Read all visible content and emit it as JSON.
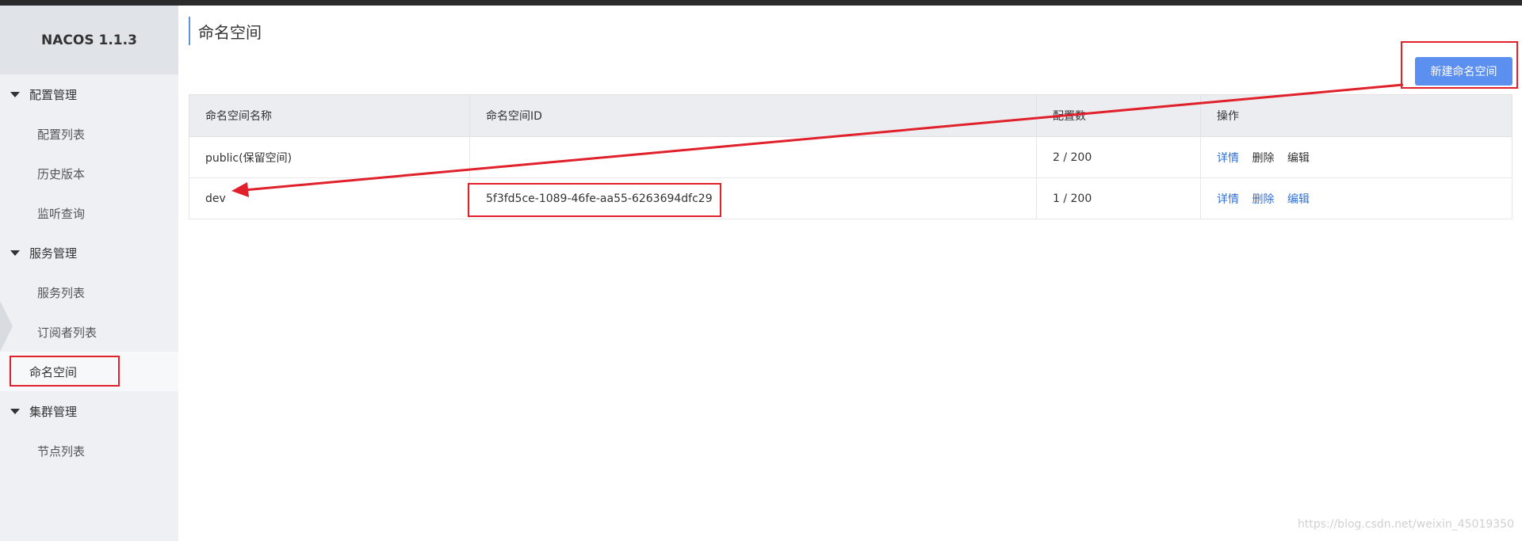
{
  "sidebar": {
    "brand": "NACOS 1.1.3",
    "groups": [
      {
        "label": "配置管理",
        "items": [
          "配置列表",
          "历史版本",
          "监听查询"
        ]
      },
      {
        "label": "服务管理",
        "items": [
          "服务列表",
          "订阅者列表"
        ]
      },
      {
        "label": "命名空间",
        "items": []
      },
      {
        "label": "集群管理",
        "items": [
          "节点列表"
        ]
      }
    ],
    "active_item": "命名空间"
  },
  "main": {
    "title": "命名空间",
    "new_button_label": "新建命名空间",
    "table": {
      "headers": [
        "命名空间名称",
        "命名空间ID",
        "配置数",
        "操作"
      ],
      "rows": [
        {
          "name": "public(保留空间)",
          "id": "",
          "count": "2 / 200",
          "ops": [
            "详情",
            "删除",
            "编辑"
          ]
        },
        {
          "name": "dev",
          "id": "5f3fd5ce-1089-46fe-aa55-6263694dfc29",
          "count": "1 / 200",
          "ops": [
            "详情",
            "删除",
            "编辑"
          ]
        }
      ]
    }
  },
  "watermark": "https://blog.csdn.net/weixin_45019350",
  "colors": {
    "primary": "#5b8ff0",
    "link": "#2f6fd6",
    "annotation": "#e0202a"
  }
}
